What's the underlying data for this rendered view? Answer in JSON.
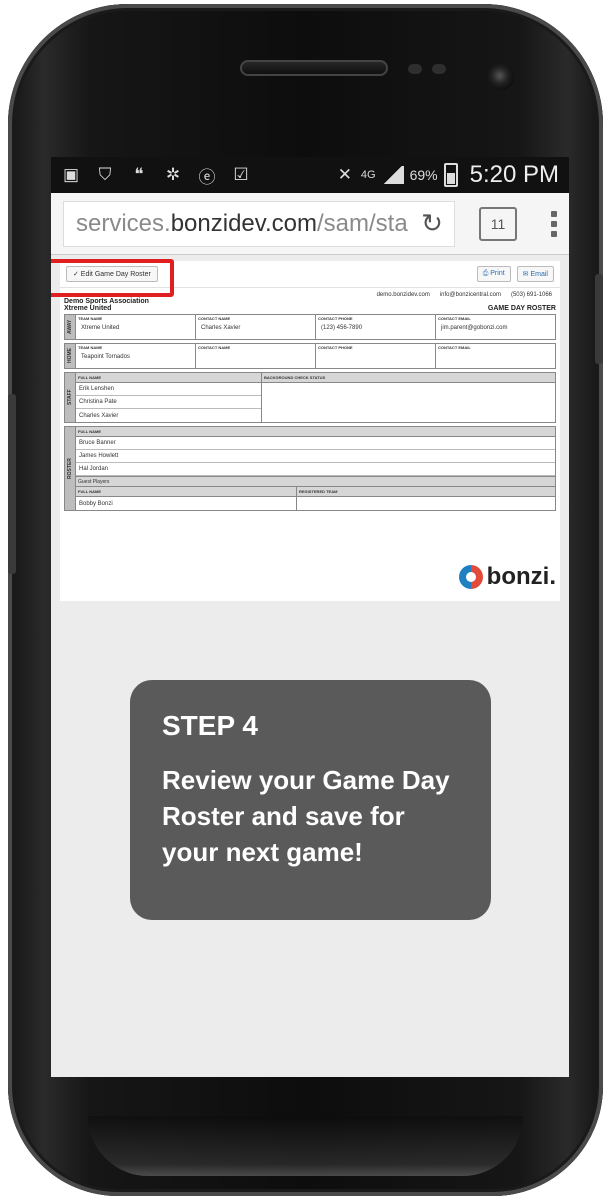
{
  "status_bar": {
    "battery_pct": "69%",
    "time": "5:20 PM",
    "network": "4G"
  },
  "browser": {
    "url_prefix": "services.",
    "url_host": "bonzidev.com",
    "url_path": "/sam/sta",
    "tab_count": "11"
  },
  "page": {
    "toolbar": {
      "edit_label": "✓ Edit Game Day Roster",
      "print_label": "⎙ Print",
      "email_label": "✉ Email"
    },
    "contacts": {
      "web": "demo.bonzidev.com",
      "email": "info@bonzicentral.com",
      "phone": "(503) 691-1066"
    },
    "org_name": "Demo Sports Association",
    "title": "GAME DAY ROSTER",
    "team_name": "Xtreme United",
    "away": {
      "label": "AWAY",
      "fields": [
        {
          "label": "TEAM NAME",
          "value": "Xtreme United"
        },
        {
          "label": "CONTACT NAME",
          "value": "Charles Xavier"
        },
        {
          "label": "CONTACT PHONE",
          "value": "(123) 456-7890"
        },
        {
          "label": "CONTACT EMAIL",
          "value": "jim.parent@gobonzi.com"
        }
      ]
    },
    "home": {
      "label": "HOME",
      "fields": [
        {
          "label": "TEAM NAME",
          "value": "Teapoint Tornados"
        },
        {
          "label": "CONTACT NAME",
          "value": ""
        },
        {
          "label": "CONTACT PHONE",
          "value": ""
        },
        {
          "label": "CONTACT EMAIL",
          "value": ""
        }
      ]
    },
    "staff": {
      "label": "STAFF",
      "col_name": "FULL NAME",
      "col_check": "BACKGROUND CHECK STATUS",
      "members": [
        "Erik Lenshen",
        "Christina Pate",
        "Charles Xavier"
      ]
    },
    "roster": {
      "label": "ROSTER",
      "col_name": "FULL NAME",
      "players": [
        "Bruce Banner",
        "James Howlett",
        "Hal Jordan"
      ],
      "guest_header": "Guest Players",
      "guest_col_name": "FULL NAME",
      "guest_col_team": "REGISTERED TEAM",
      "guests": [
        "Bobby Bonzi"
      ]
    },
    "brand": "bonzi."
  },
  "callout": {
    "title": "STEP 4",
    "text": "Review your Game Day Roster and save for your next game!"
  }
}
